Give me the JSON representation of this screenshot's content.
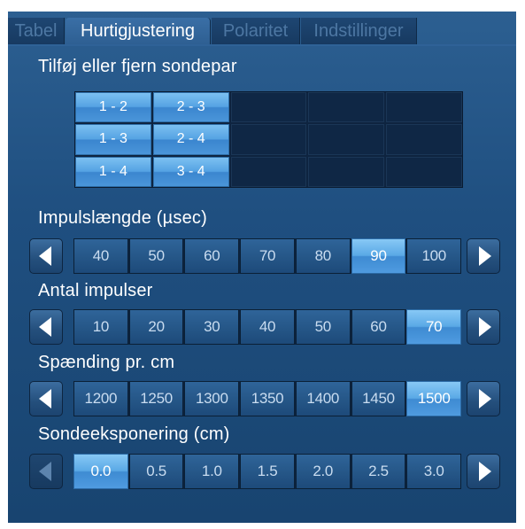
{
  "tabs": [
    {
      "label": "Tabel"
    },
    {
      "label": "Hurtigjustering"
    },
    {
      "label": "Polaritet"
    },
    {
      "label": "Indstillinger"
    }
  ],
  "probe_pairs": {
    "title": "Tilføj eller fjern sondepar",
    "cells": [
      "1 - 2",
      "2 - 3",
      "",
      "",
      "",
      "1 - 3",
      "2 - 4",
      "",
      "",
      "",
      "1 - 4",
      "3 - 4",
      "",
      "",
      ""
    ]
  },
  "pulse_length": {
    "title": "Impulslængde (µsec)",
    "options": [
      "40",
      "50",
      "60",
      "70",
      "80",
      "90",
      "100"
    ],
    "selected": "90"
  },
  "pulse_count": {
    "title": "Antal impulser",
    "options": [
      "10",
      "20",
      "30",
      "40",
      "50",
      "60",
      "70"
    ],
    "selected": "70"
  },
  "voltage": {
    "title": "Spænding pr. cm",
    "options": [
      "1200",
      "1250",
      "1300",
      "1350",
      "1400",
      "1450",
      "1500"
    ],
    "selected": "1500"
  },
  "exposure": {
    "title": "Sondeeksponering (cm)",
    "options": [
      "0.0",
      "0.5",
      "1.0",
      "1.5",
      "2.0",
      "2.5",
      "3.0"
    ],
    "selected": "0.0"
  },
  "colors": {
    "panel": "#1f4f80",
    "selected": "#5aa9e6",
    "dark_cell": "#0f2745"
  }
}
